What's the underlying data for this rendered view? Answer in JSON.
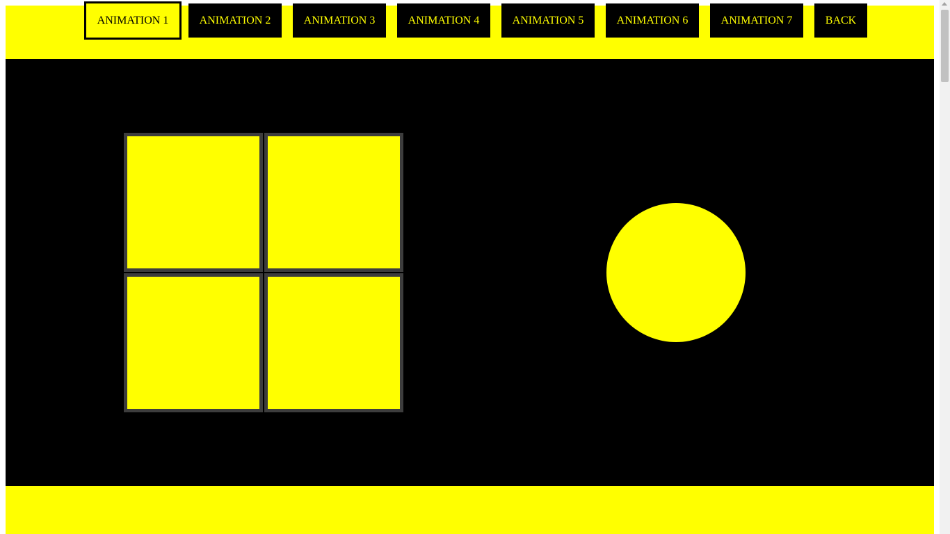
{
  "nav": {
    "buttons": [
      {
        "label": "ANIMATION 1"
      },
      {
        "label": "ANIMATION 2"
      },
      {
        "label": "ANIMATION 3"
      },
      {
        "label": "ANIMATION 4"
      },
      {
        "label": "ANIMATION 5"
      },
      {
        "label": "ANIMATION 6"
      },
      {
        "label": "ANIMATION 7"
      },
      {
        "label": "BACK"
      }
    ],
    "active_index": 0
  },
  "colors": {
    "accent": "#ffff00",
    "stage": "#000000",
    "tile_border": "#3d3d3d"
  }
}
